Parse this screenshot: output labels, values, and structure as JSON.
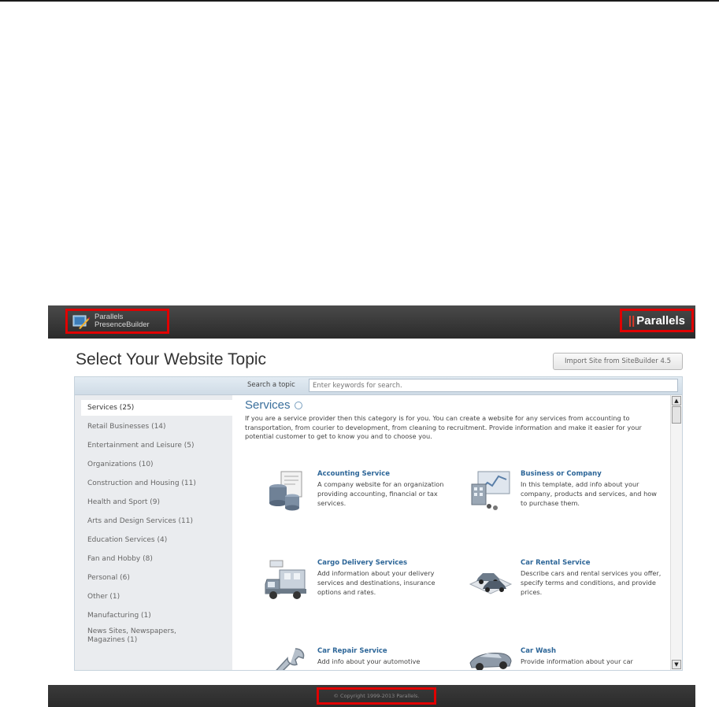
{
  "header": {
    "brand_line1": "Parallels",
    "brand_line2": "PresenceBuilder",
    "logo_mark": "||",
    "logo_text": "Parallels",
    "brand_icon": "presence-builder-logo-icon"
  },
  "page_title": "Select Your Website Topic",
  "import_button": "Import Site from SiteBuilder 4.5",
  "search": {
    "label": "Search a topic",
    "placeholder": "Enter keywords for search."
  },
  "categories": [
    "Services (25)",
    "Retail Businesses (14)",
    "Entertainment and Leisure (5)",
    "Organizations (10)",
    "Construction and Housing (11)",
    "Health and Sport (9)",
    "Arts and Design Services (11)",
    "Education Services (4)",
    "Fan and Hobby (8)",
    "Personal (6)",
    "Other (1)",
    "Manufacturing (1)",
    "News Sites, Newspapers, Magazines (1)"
  ],
  "active_category": "Services (25)",
  "section": {
    "title": "Services",
    "description": "If you are a service provider then this category is for you. You can create a website for any services from accounting to transportation, from courier to development, from cleaning to recruitment. Provide information and make it easier for your potential customer to get to know you and to choose you."
  },
  "topics": [
    {
      "title": "Accounting Service",
      "desc": "A company website for an organization providing accounting, financial or tax services.",
      "icon": "accounting-icon"
    },
    {
      "title": "Business or Company",
      "desc": "In this template, add info about your company, products and services, and how to purchase them.",
      "icon": "business-icon"
    },
    {
      "title": "Cargo Delivery Services",
      "desc": "Add information about your delivery services and destinations, insurance options and rates.",
      "icon": "truck-icon"
    },
    {
      "title": "Car Rental Service",
      "desc": "Describe cars and rental services you offer, specify terms and conditions, and provide prices.",
      "icon": "car-rental-icon"
    },
    {
      "title": "Car Repair Service",
      "desc": "Add info about your automotive",
      "icon": "wrench-icon"
    },
    {
      "title": "Car Wash",
      "desc": "Provide information about your car",
      "icon": "car-icon"
    }
  ],
  "scroll_up": "▲",
  "scroll_down": "▼",
  "footer": {
    "copyright": "© Copyright 1999-2013 Parallels."
  },
  "colors": {
    "header_bg": "#2e2e2e",
    "accent_link": "#2d6698",
    "highlight_border": "#e00000",
    "sidebar_bg": "#eaecef"
  }
}
